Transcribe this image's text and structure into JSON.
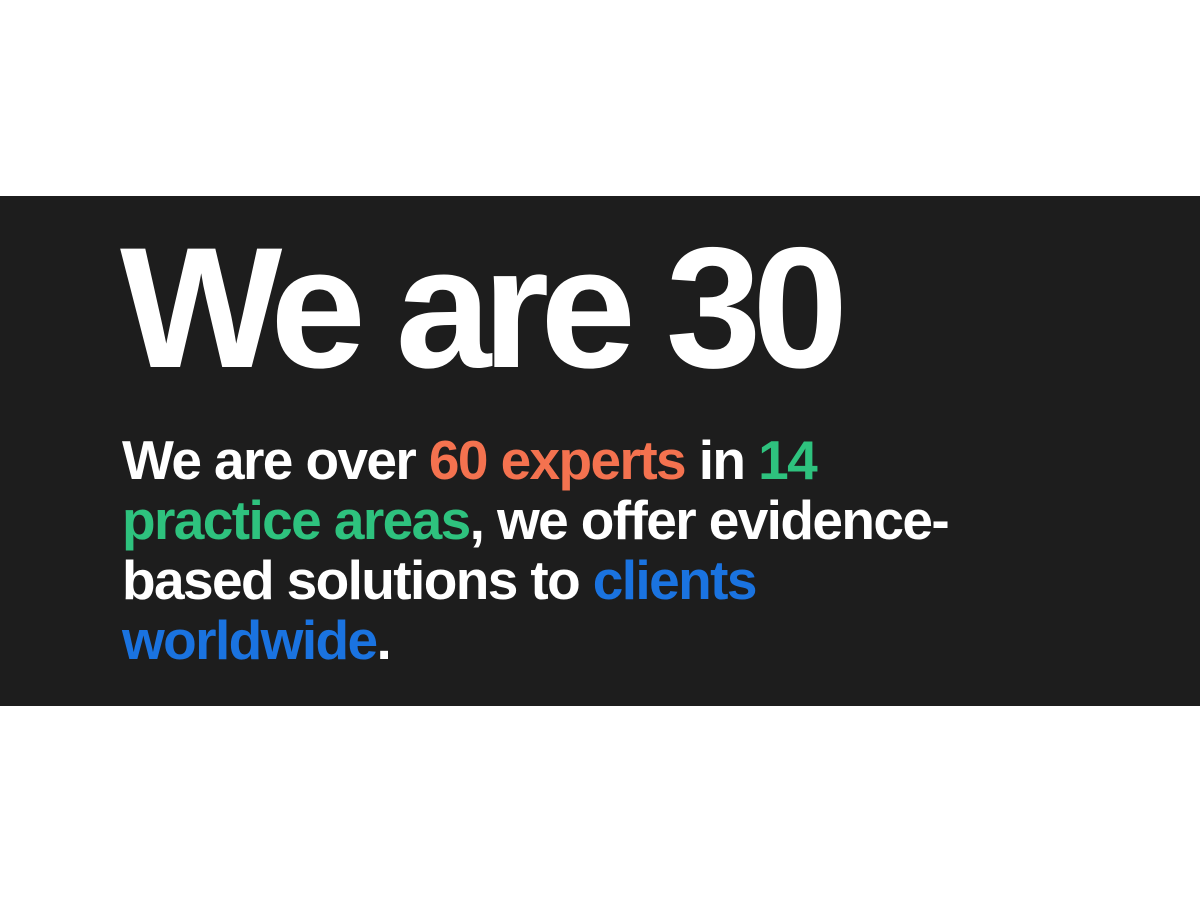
{
  "headline": "We are 30",
  "statement": {
    "lines": [
      [
        {
          "text": "We are over ",
          "color": "#ffffff"
        },
        {
          "text": "60 experts",
          "color": "#f4724f"
        },
        {
          "text": " in ",
          "color": "#ffffff"
        },
        {
          "text": "14",
          "color": "#2ec27e"
        }
      ],
      [
        {
          "text": "practice areas",
          "color": "#2ec27e"
        },
        {
          "text": ", we offer evidence-",
          "color": "#ffffff"
        }
      ],
      [
        {
          "text": "based solutions to ",
          "color": "#ffffff"
        },
        {
          "text": "clients",
          "color": "#1a73e0"
        }
      ],
      [
        {
          "text": "worldwide",
          "color": "#1a73e0"
        },
        {
          "text": ".",
          "color": "#ffffff"
        }
      ]
    ]
  },
  "colors": {
    "banner_background": "#1d1d1d",
    "page_background": "#ffffff",
    "text_primary": "#ffffff",
    "accent_orange": "#f4724f",
    "accent_green": "#2ec27e",
    "accent_blue": "#1a73e0"
  }
}
